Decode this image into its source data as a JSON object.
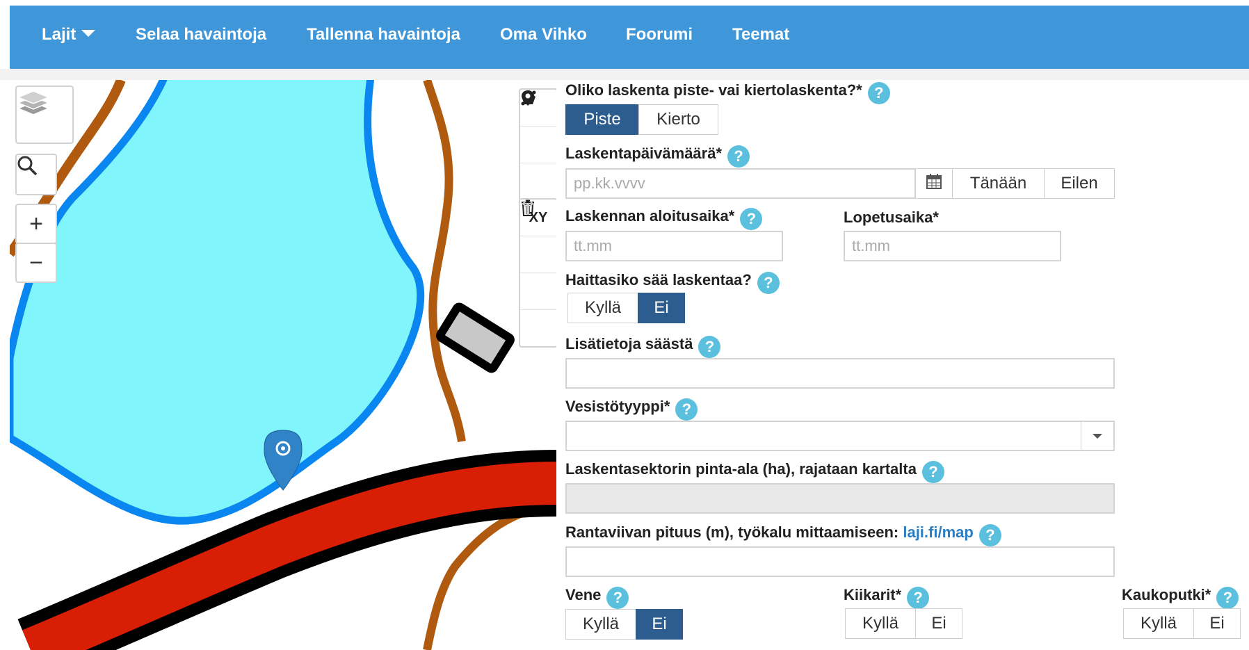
{
  "navbar": {
    "bg": "#3f97d9",
    "items": [
      "Lajit",
      "Selaa havaintoja",
      "Tallenna havaintoja",
      "Oma Vihko",
      "Foorumi",
      "Teemat"
    ]
  },
  "map": {
    "controls": {
      "zoom_in": "+",
      "zoom_out": "−",
      "xy": "XY"
    },
    "colors": {
      "water": "#80f6fc",
      "shore": "#0a86f0",
      "road": "#d81e05",
      "trail": "#b05a10",
      "marker": "#3183c8"
    }
  },
  "form": {
    "help_glyph": "?",
    "count_type": {
      "label": "Oliko laskenta piste- vai kiertolaskenta?*",
      "options": [
        "Piste",
        "Kierto"
      ],
      "selected": "Piste"
    },
    "date": {
      "label": "Laskentapäivämäärä*",
      "placeholder": "pp.kk.vvvv",
      "today": "Tänään",
      "yesterday": "Eilen"
    },
    "start_time": {
      "label": "Laskennan aloitusaika*",
      "placeholder": "tt.mm"
    },
    "end_time": {
      "label": "Lopetusaika*",
      "placeholder": "tt.mm"
    },
    "weather": {
      "label": "Haittasiko sää laskentaa?",
      "options": [
        "Kyllä",
        "Ei"
      ],
      "selected": "Ei"
    },
    "weather_info": {
      "label": "Lisätietoja säästä",
      "value": ""
    },
    "water_type": {
      "label": "Vesistötyyppi*",
      "value": ""
    },
    "sector_area": {
      "label": "Laskentasektorin pinta-ala (ha), rajataan kartalta",
      "value": ""
    },
    "shoreline": {
      "label": "Rantaviivan pituus (m), työkalu mittaamiseen: ",
      "link": "laji.fi/map",
      "value": ""
    },
    "boat": {
      "label": "Vene",
      "options": [
        "Kyllä",
        "Ei"
      ],
      "selected": "Ei"
    },
    "binoculars": {
      "label": "Kiikarit*",
      "options": [
        "Kyllä",
        "Ei"
      ],
      "selected": ""
    },
    "telescope": {
      "label": "Kaukoputki*",
      "options": [
        "Kyllä",
        "Ei"
      ],
      "selected": ""
    }
  }
}
